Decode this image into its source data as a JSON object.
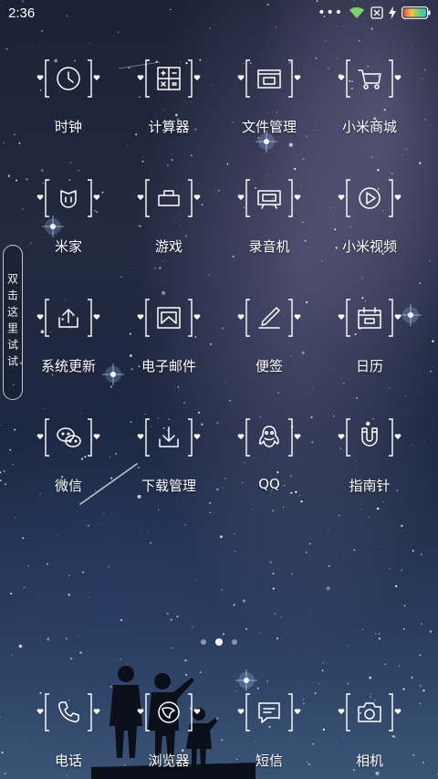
{
  "status_bar": {
    "time": "2:36",
    "icons": [
      "more-dots-icon",
      "wifi-icon",
      "sim-off-icon",
      "charging-bolt-icon",
      "battery-icon"
    ]
  },
  "side_hint": {
    "text": "双击这里试试"
  },
  "apps": [
    {
      "label": "时钟",
      "icon": "clock-icon"
    },
    {
      "label": "计算器",
      "icon": "calculator-icon"
    },
    {
      "label": "文件管理",
      "icon": "file-manager-icon"
    },
    {
      "label": "小米商城",
      "icon": "shopping-cart-icon"
    },
    {
      "label": "米家",
      "icon": "mijia-icon"
    },
    {
      "label": "游戏",
      "icon": "game-icon"
    },
    {
      "label": "录音机",
      "icon": "recorder-icon"
    },
    {
      "label": "小米视频",
      "icon": "video-play-icon"
    },
    {
      "label": "系统更新",
      "icon": "system-update-icon"
    },
    {
      "label": "电子邮件",
      "icon": "email-icon"
    },
    {
      "label": "便签",
      "icon": "notes-pen-icon"
    },
    {
      "label": "日历",
      "icon": "calendar-icon"
    },
    {
      "label": "微信",
      "icon": "wechat-icon"
    },
    {
      "label": "下载管理",
      "icon": "download-icon"
    },
    {
      "label": "QQ",
      "icon": "qq-penguin-icon"
    },
    {
      "label": "指南针",
      "icon": "compass-magnet-icon"
    }
  ],
  "pagination": {
    "count": 3,
    "active": 1
  },
  "dock": [
    {
      "label": "电话",
      "icon": "phone-icon"
    },
    {
      "label": "浏览器",
      "icon": "browser-icon"
    },
    {
      "label": "短信",
      "icon": "message-icon"
    },
    {
      "label": "相机",
      "icon": "camera-icon"
    }
  ],
  "colors": {
    "icon_stroke": "#ffffff",
    "battery_gradient": [
      "#e8503a",
      "#f2c84b",
      "#5fd36b",
      "#3fb8e8"
    ]
  }
}
